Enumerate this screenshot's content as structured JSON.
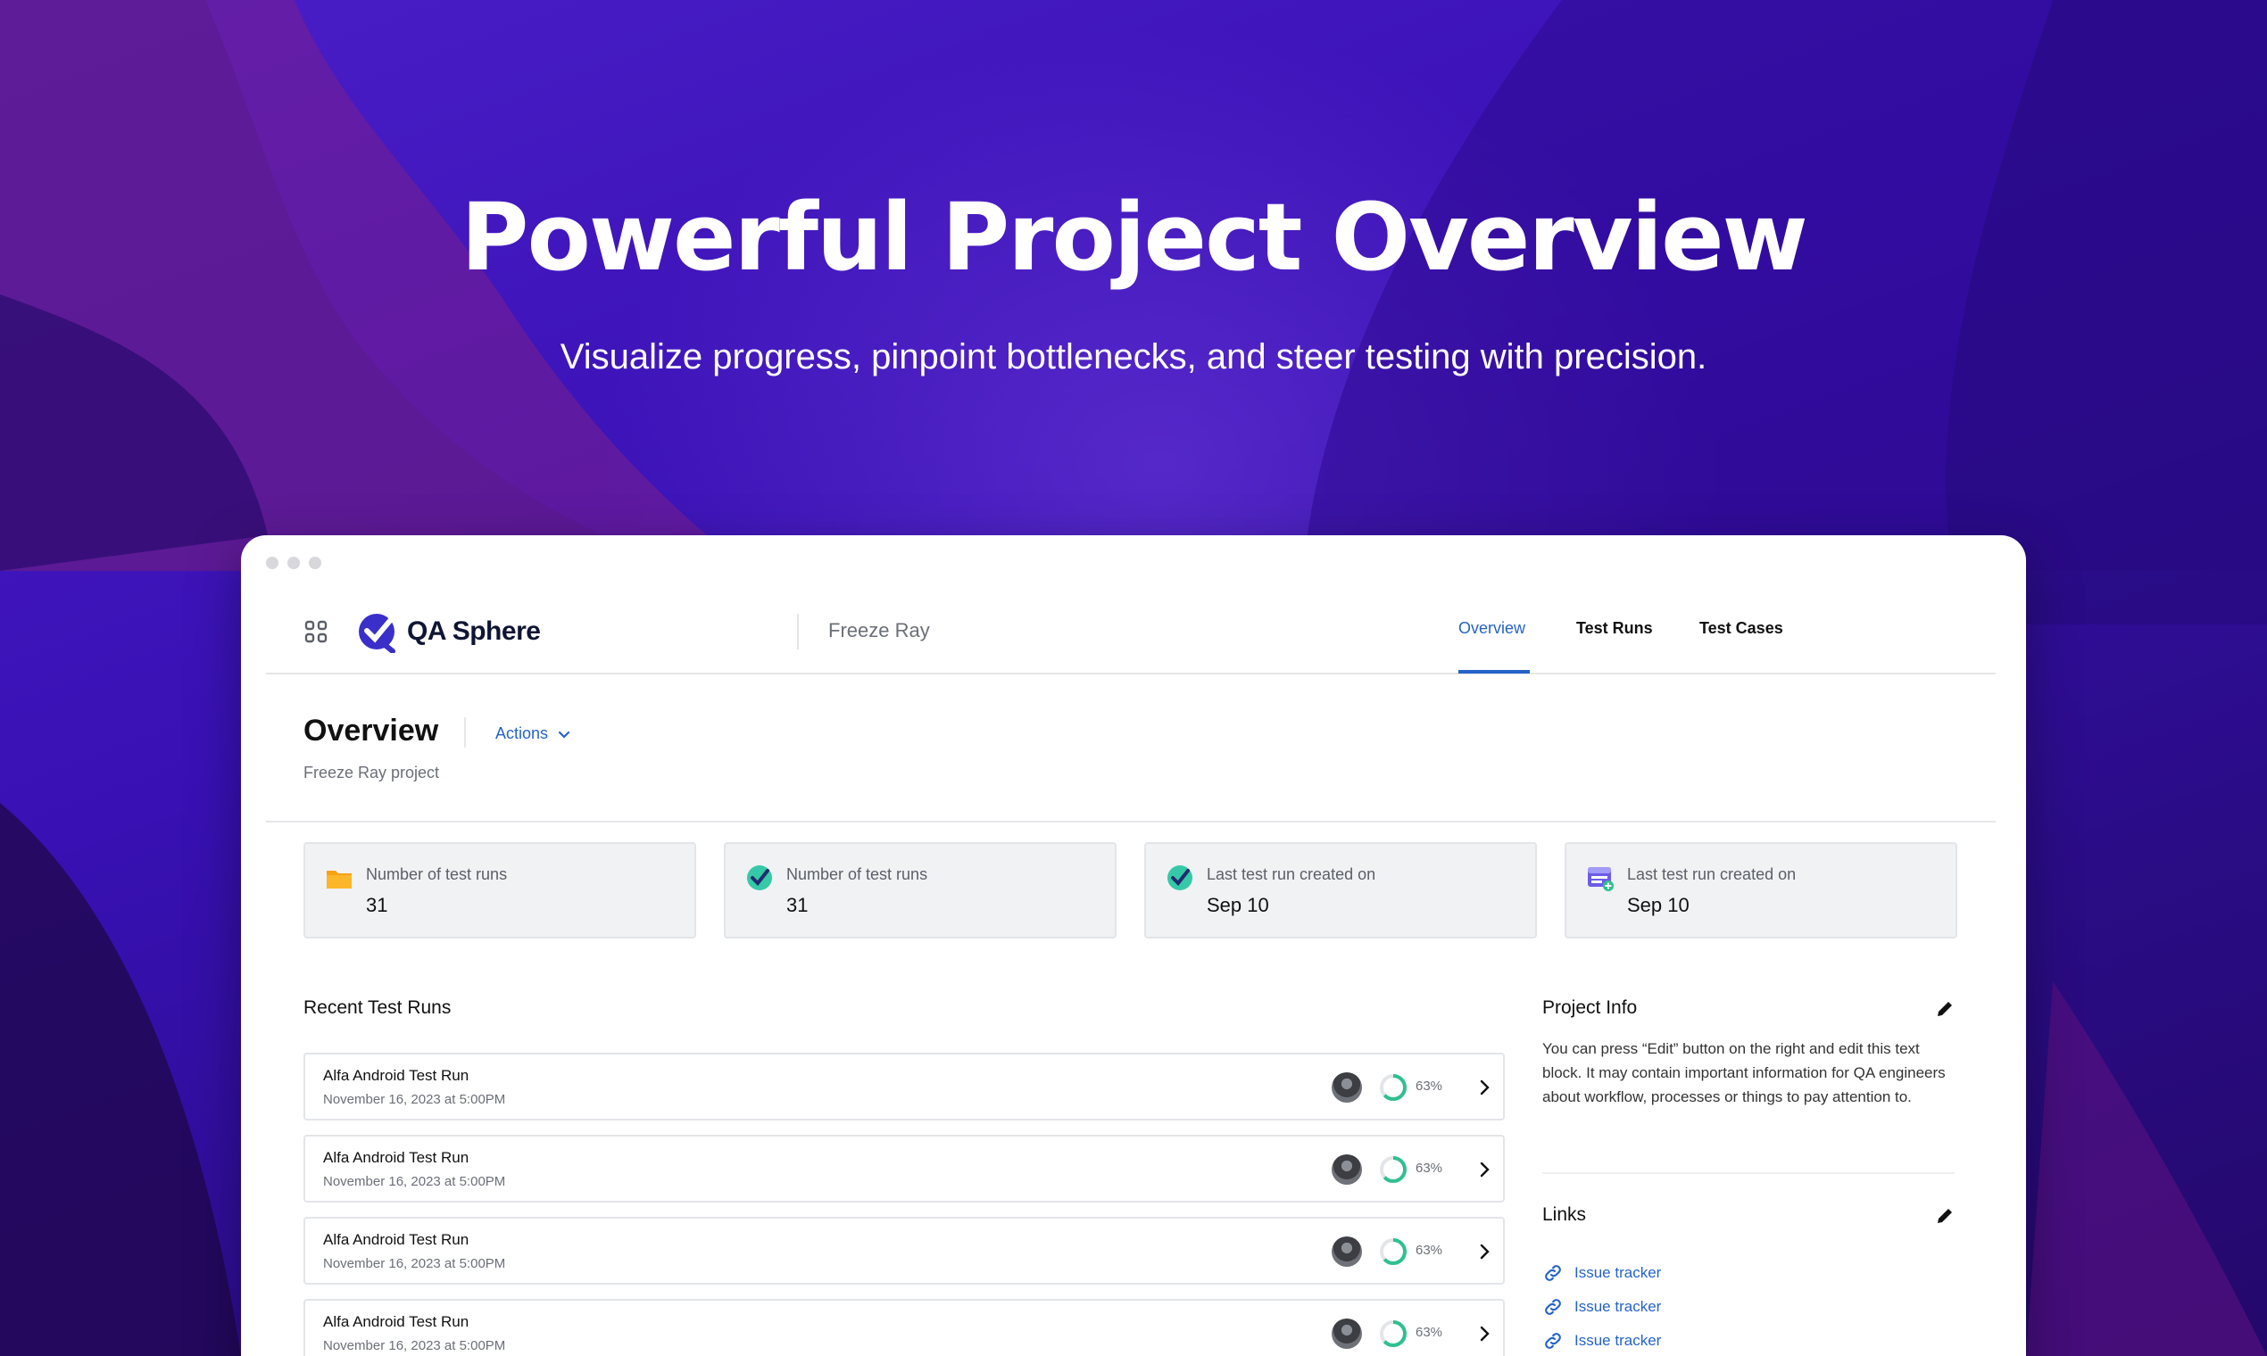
{
  "hero": {
    "title": "Powerful Project Overview",
    "subtitle": "Visualize progress, pinpoint bottlenecks, and steer testing with precision."
  },
  "app": {
    "name": "QA Sphere",
    "project": "Freeze Ray",
    "nav": {
      "tabs": [
        {
          "label": "Overview",
          "active": true
        },
        {
          "label": "Test Runs",
          "active": false
        },
        {
          "label": "Test Cases",
          "active": false
        }
      ]
    }
  },
  "overview": {
    "title": "Overview",
    "actions_label": "Actions",
    "subtitle": "Freeze Ray project"
  },
  "stats": [
    {
      "icon": "folder-icon",
      "label": "Number of test runs",
      "value": "31"
    },
    {
      "icon": "check-badge-icon",
      "label": "Number of test runs",
      "value": "31"
    },
    {
      "icon": "check-badge-icon",
      "label": "Last test run created on",
      "value": "Sep 10"
    },
    {
      "icon": "calendar-add-icon",
      "label": "Last test run created on",
      "value": "Sep 10"
    }
  ],
  "recent": {
    "title": "Recent Test Runs",
    "runs": [
      {
        "title": "Alfa Android Test Run",
        "date": "November 16, 2023 at 5:00PM",
        "progress": "63%"
      },
      {
        "title": "Alfa Android Test Run",
        "date": "November 16, 2023 at 5:00PM",
        "progress": "63%"
      },
      {
        "title": "Alfa Android Test Run",
        "date": "November 16, 2023 at 5:00PM",
        "progress": "63%"
      },
      {
        "title": "Alfa Android Test Run",
        "date": "November 16, 2023 at 5:00PM",
        "progress": "63%"
      }
    ]
  },
  "project_info": {
    "title": "Project Info",
    "text": "You can press “Edit” button on the right and edit this text block. It may contain important information for QA engineers about workflow, processes or things to pay attention to."
  },
  "links": {
    "title": "Links",
    "items": [
      "Issue tracker",
      "Issue tracker",
      "Issue tracker"
    ]
  },
  "colors": {
    "accent": "#2563c9",
    "progress": "#2fc08f",
    "background": "#3a0fb8"
  }
}
